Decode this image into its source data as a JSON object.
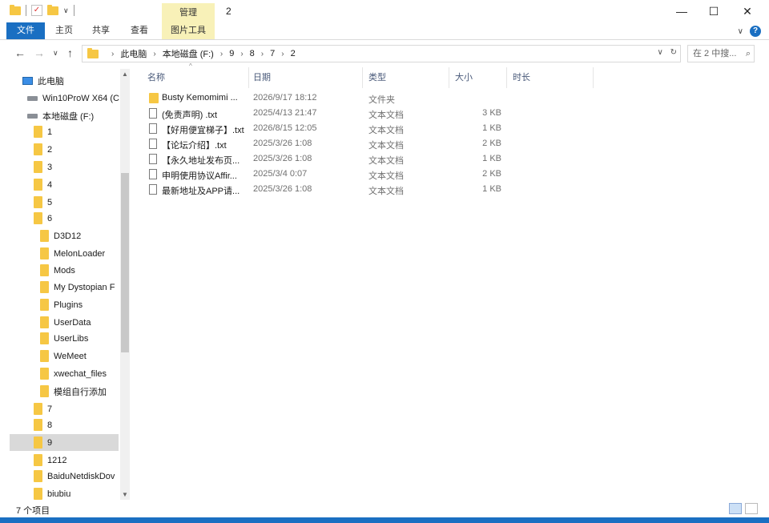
{
  "titlebar": {
    "manage_tab": "管理",
    "title": "2",
    "minimize": "—",
    "maximize": "☐",
    "close": "✕",
    "dropdown": "∨"
  },
  "ribbon": {
    "tabs": [
      "文件",
      "主页",
      "共享",
      "查看",
      "图片工具"
    ],
    "collapse": "∨",
    "help": "?"
  },
  "address": {
    "crumbs": [
      "此电脑",
      "本地磁盘 (F:)",
      "9",
      "8",
      "7",
      "2"
    ],
    "dropdown": "∨",
    "refresh": "↻",
    "search_placeholder": "在 2 中搜..."
  },
  "nav": {
    "items": [
      {
        "label": "此电脑",
        "icon": "computer-icon",
        "selected": false
      },
      {
        "label": "Win10ProW X64 (C",
        "icon": "drive-icon",
        "selected": false
      },
      {
        "label": "本地磁盘 (F:)",
        "icon": "drive-icon",
        "selected": false
      },
      {
        "label": "1",
        "icon": "folder-icon",
        "selected": false
      },
      {
        "label": "2",
        "icon": "folder-icon",
        "selected": false
      },
      {
        "label": "3",
        "icon": "folder-icon",
        "selected": false
      },
      {
        "label": "4",
        "icon": "folder-icon",
        "selected": false
      },
      {
        "label": "5",
        "icon": "folder-icon",
        "selected": false
      },
      {
        "label": "6",
        "icon": "folder-icon",
        "selected": false
      },
      {
        "label": "D3D12",
        "icon": "folder-icon",
        "selected": false
      },
      {
        "label": "MelonLoader",
        "icon": "folder-icon",
        "selected": false
      },
      {
        "label": "Mods",
        "icon": "folder-icon",
        "selected": false
      },
      {
        "label": "My Dystopian F",
        "icon": "folder-icon",
        "selected": false
      },
      {
        "label": "Plugins",
        "icon": "folder-icon",
        "selected": false
      },
      {
        "label": "UserData",
        "icon": "folder-icon",
        "selected": false
      },
      {
        "label": "UserLibs",
        "icon": "folder-icon",
        "selected": false
      },
      {
        "label": "WeMeet",
        "icon": "folder-icon",
        "selected": false
      },
      {
        "label": "xwechat_files",
        "icon": "folder-icon",
        "selected": false
      },
      {
        "label": "模组自行添加",
        "icon": "folder-icon",
        "selected": false
      },
      {
        "label": "7",
        "icon": "folder-icon",
        "selected": false
      },
      {
        "label": "8",
        "icon": "folder-icon",
        "selected": false
      },
      {
        "label": "9",
        "icon": "folder-icon",
        "selected": true
      },
      {
        "label": "1212",
        "icon": "folder-icon",
        "selected": false
      },
      {
        "label": "BaiduNetdiskDov",
        "icon": "folder-icon",
        "selected": false
      },
      {
        "label": "biubiu",
        "icon": "folder-icon",
        "selected": false
      }
    ]
  },
  "columns": {
    "name": "名称",
    "date": "日期",
    "type": "类型",
    "size": "大小",
    "duration": "时长"
  },
  "files": [
    {
      "name": "Busty Kemomimi ...",
      "date": "2026/9/17 18:12",
      "type": "文件夹",
      "size": "",
      "kind": "folder"
    },
    {
      "name": "(免责声明) .txt",
      "date": "2025/4/13 21:47",
      "type": "文本文档",
      "size": "3 KB",
      "kind": "file"
    },
    {
      "name": "【好用便宜梯子】.txt",
      "date": "2026/8/15 12:05",
      "type": "文本文档",
      "size": "1 KB",
      "kind": "file"
    },
    {
      "name": "【论坛介绍】.txt",
      "date": "2025/3/26 1:08",
      "type": "文本文档",
      "size": "2 KB",
      "kind": "file"
    },
    {
      "name": "【永久地址发布页...",
      "date": "2025/3/26 1:08",
      "type": "文本文档",
      "size": "1 KB",
      "kind": "file"
    },
    {
      "name": "申明使用协议Affir...",
      "date": "2025/3/4 0:07",
      "type": "文本文档",
      "size": "2 KB",
      "kind": "file"
    },
    {
      "name": "最新地址及APP请...",
      "date": "2025/3/26 1:08",
      "type": "文本文档",
      "size": "1 KB",
      "kind": "file"
    }
  ],
  "status": {
    "count": "7 个项目"
  },
  "colors": {
    "accent": "#1a6fc2",
    "manage_tab": "#f8f1b8",
    "folder": "#f6c744",
    "selected": "#d9d9d9"
  }
}
